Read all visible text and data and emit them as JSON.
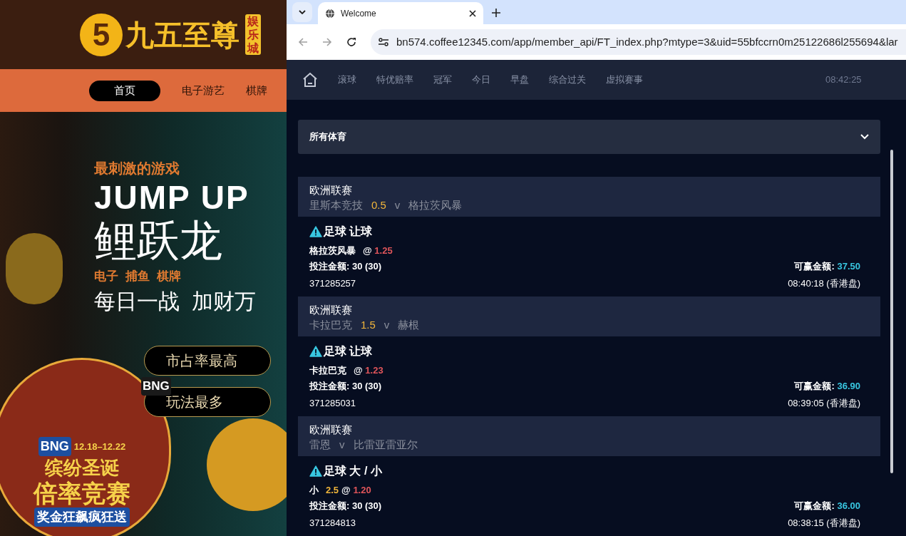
{
  "site": {
    "logo_mark": "5",
    "logo_text": "九五至尊",
    "logo_badge": "娱乐城",
    "nav": [
      {
        "label": "首页",
        "selected": true
      },
      {
        "label": "电子游艺",
        "selected": false
      },
      {
        "label": "棋牌",
        "selected": false
      }
    ],
    "banner": {
      "kicker": "最刺激的游戏",
      "headline": "JUMP UP",
      "title": "鲤跃龙",
      "tags": [
        "电子",
        "捕鱼",
        "棋牌"
      ],
      "slogan": "每日一战  加财万",
      "pills": [
        "市占率最高",
        "玩法最多"
      ],
      "brand": "BNG",
      "promo": {
        "brand": "BNG",
        "dates": "12.18–12.22",
        "line_1": "缤纷圣诞",
        "line_2": "倍率竞赛",
        "line_3": "奖金狂飙疯狂送"
      }
    }
  },
  "browser": {
    "tab": {
      "title": "Welcome"
    },
    "url": "bn574.coffee12345.com/app/member_api/FT_index.php?mtype=3&uid=55bfccrn0m25122686l255694&lar"
  },
  "app": {
    "nav": [
      {
        "label": "滚球"
      },
      {
        "label": "特优赔率"
      },
      {
        "label": "冠军"
      },
      {
        "label": "今日"
      },
      {
        "label": "早盘"
      },
      {
        "label": "综合过关"
      },
      {
        "label": "虚拟赛事"
      }
    ],
    "time": "08:42:25",
    "filter": {
      "value": "所有体育"
    },
    "bets": [
      {
        "league": "欧洲联赛",
        "home": "里斯本竞技",
        "handicap": "0.5",
        "separator": "v",
        "away": "格拉茨风暴",
        "market": "足球 让球",
        "selection": "格拉茨风暴",
        "at": "@",
        "odds": "1.25",
        "stake_label": "投注金额:",
        "stake": "30 (30)",
        "win_label": "可赢金额:",
        "win": "37.50",
        "ticket": "371285257",
        "time": "08:40:18 (香港盘)"
      },
      {
        "league": "欧洲联赛",
        "home": "卡拉巴克",
        "handicap": "1.5",
        "separator": "v",
        "away": "赫根",
        "market": "足球 让球",
        "selection": "卡拉巴克",
        "at": "@",
        "odds": "1.23",
        "stake_label": "投注金额:",
        "stake": "30 (30)",
        "win_label": "可赢金额:",
        "win": "36.90",
        "ticket": "371285031",
        "time": "08:39:05 (香港盘)"
      },
      {
        "league": "欧洲联赛",
        "home": "雷恩",
        "separator": "v",
        "away": "比雷亚雷亚尔",
        "market": "足球 大 / 小",
        "selection": "小",
        "line": "2.5",
        "at": "@",
        "odds": "1.20",
        "stake_label": "投注金额:",
        "stake": "30 (30)",
        "win_label": "可赢金额:",
        "win": "36.00",
        "ticket": "371284813",
        "time": "08:38:15 (香港盘)"
      }
    ]
  }
}
